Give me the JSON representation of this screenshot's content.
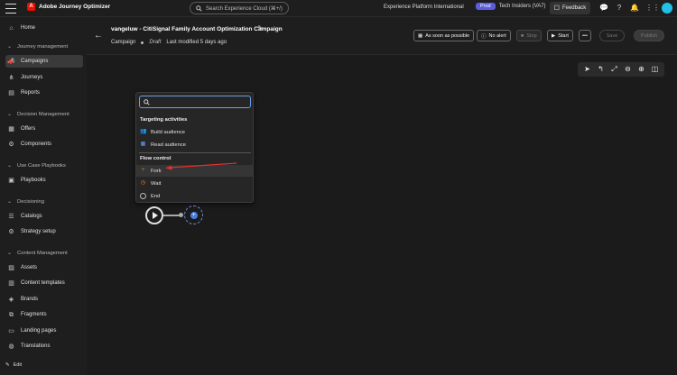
{
  "app": {
    "name": "Adobe Journey Optimizer",
    "search_placeholder": "Search Experience Cloud (⌘+/)",
    "org": "Experience Platform International",
    "sandbox_badge": "Prod",
    "sandbox_name": "Tech Insiders (VA7)",
    "feedback_label": "Feedback"
  },
  "sidebar": {
    "home": "Home",
    "sections": {
      "journey_management": "Journey management",
      "decision_management": "Decision Management",
      "use_case_playbooks": "Use Case Playbooks",
      "decisioning": "Decisioning",
      "content_management": "Content Management"
    },
    "items": {
      "campaigns": "Campaigns",
      "journeys": "Journeys",
      "reports": "Reports",
      "offers": "Offers",
      "components": "Components",
      "playbooks": "Playbooks",
      "catalogs": "Catalogs",
      "strategy_setup": "Strategy setup",
      "assets": "Assets",
      "content_templates": "Content templates",
      "brands": "Brands",
      "fragments": "Fragments",
      "landing_pages": "Landing pages",
      "translations": "Translations"
    },
    "edit_label": "Edit"
  },
  "header": {
    "title": "vangeluw - CitiSignal Family Account Optimization Campaign",
    "type": "Campaign",
    "status": "Draft",
    "last_modified": "Last modified 5 days ago",
    "buttons": {
      "schedule": "As soon as possible",
      "alert": "No alert",
      "stop": "Stop",
      "start": "Start",
      "more": "•••",
      "save": "Save",
      "publish": "Publish"
    }
  },
  "popover": {
    "search_value": "",
    "targeting_heading": "Targeting activities",
    "build_audience": "Build audience",
    "read_audience": "Read audience",
    "flow_heading": "Flow control",
    "fork": "Fork",
    "wait": "Wait",
    "end": "End"
  },
  "colors": {
    "accent_blue": "#4a7ee0",
    "flow_orange": "#f08a24",
    "annotation_red": "#e03030",
    "prod_badge": "#5c5ce0",
    "brand_red": "#eb1000"
  }
}
